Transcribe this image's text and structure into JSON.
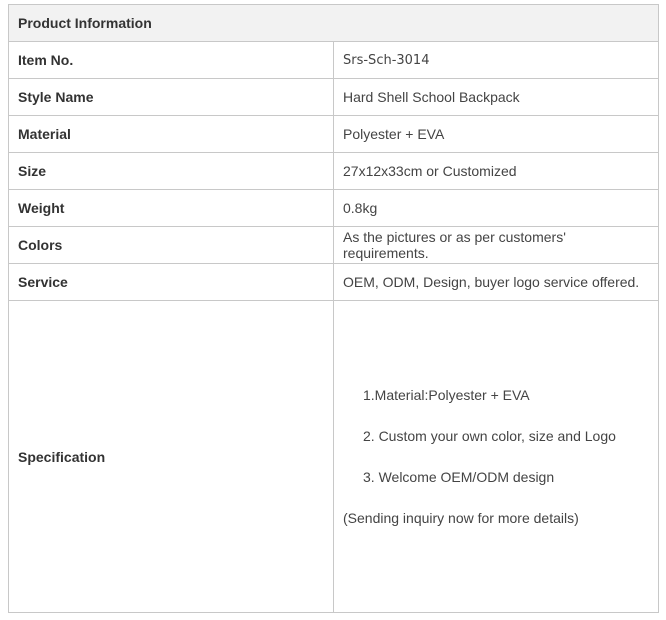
{
  "table": {
    "header": "Product Information",
    "rows": [
      {
        "label": "Item No.",
        "value": "Srs-Sch-3014"
      },
      {
        "label": "Style  Name",
        "value": "Hard  Shell School Backpack"
      },
      {
        "label": "Material",
        "value": "Polyester  + EVA"
      },
      {
        "label": "Size",
        "value": "27x12x33cm  or Customized"
      },
      {
        "label": "Weight",
        "value": "0.8kg"
      },
      {
        "label": "Colors",
        "value": "As the pictures or as per customers' requirements."
      },
      {
        "label": "Service",
        "value": "OEM, ODM, Design, buyer logo service offered."
      }
    ],
    "specification": {
      "label": "Specification",
      "items": [
        "1.Material:Polyester + EVA",
        "2. Custom your own color, size and Logo",
        "3. Welcome OEM/ODM design"
      ],
      "note": "(Sending inquiry now for more details)"
    }
  }
}
